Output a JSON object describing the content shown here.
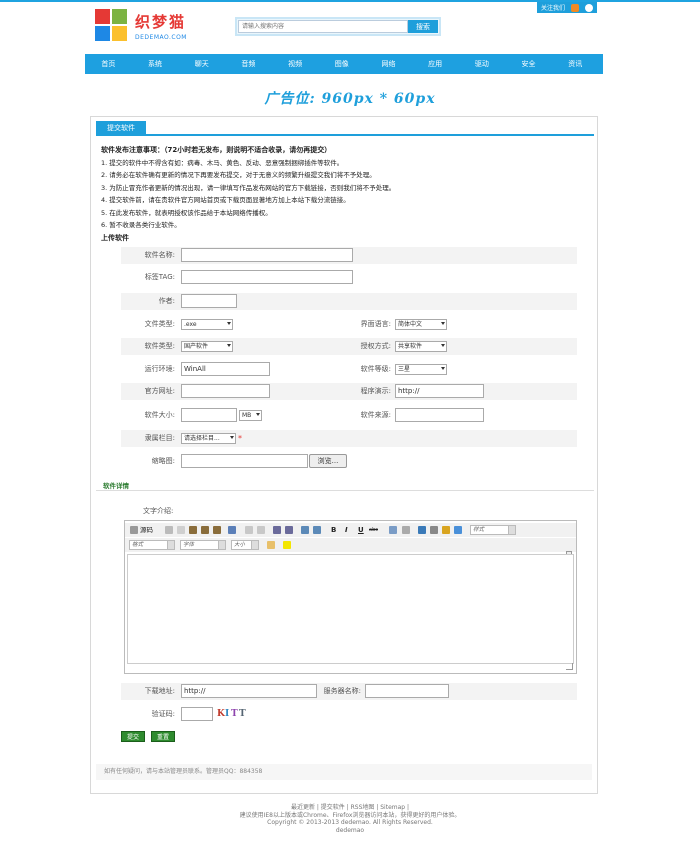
{
  "top": {
    "follow": "关注我们"
  },
  "brand": {
    "name": "织梦猫",
    "sub": "DEDEMAO.COM"
  },
  "search": {
    "placeholder": "请输入搜索内容",
    "button": "搜索"
  },
  "nav": [
    "首页",
    "系统",
    "聊天",
    "音频",
    "视频",
    "图像",
    "网络",
    "应用",
    "驱动",
    "安全",
    "资讯"
  ],
  "ad": "广告位: 960px * 60px",
  "tab": "提交软件",
  "notice": {
    "title": "软件发布注意事项：（72小时若无发布，则说明不适合收录，请勿再提交）",
    "items": [
      "1. 提交的软件中不得含有如：病毒、木马、黄色、反动、恶意强制捆绑插件等软件。",
      "2. 请务必在软件确有更新的情况下再要发布提交，对于无意义的频繁升级提交我们将不予处理。",
      "3. 为防止冒充作者更新的情况出现，请一律填写作品发布网站的官方下载链接，否则我们将不予处理。",
      "4. 提交软件前，请在贵软件官方网站首页或下载页面显著地方加上本站下载分流链接。",
      "5. 在此发布软件，就表明授权该作品给于本站网络传播权。",
      "6. 暂不收录各类行业软件。"
    ],
    "upload_title": "上传软件"
  },
  "form": {
    "name_label": "软件名称:",
    "tag_label": "标签TAG:",
    "author_label": "作者:",
    "filetype_label": "文件类型:",
    "filetype_value": ".exe",
    "lang_label": "界面语言:",
    "lang_value": "简体中文",
    "softtype_label": "软件类型:",
    "softtype_value": "国产软件",
    "license_label": "授权方式:",
    "license_value": "共享软件",
    "env_label": "运行环境:",
    "env_value": "WinAll",
    "rank_label": "软件等级:",
    "rank_value": "三星",
    "site_label": "官方网址:",
    "demo_label": "程序演示:",
    "demo_value": "http://",
    "size_label": "软件大小:",
    "size_unit": "MB",
    "source_label": "软件来源:",
    "cat_label": "隶属栏目:",
    "cat_value": "请选择栏目...",
    "cat_star": "*",
    "thumb_label": "缩略图:",
    "browse": "浏览..."
  },
  "detail": {
    "section": "软件详情",
    "intro_label": "文字介绍:",
    "toolbar": {
      "source": "源码",
      "bold": "B",
      "italic": "I",
      "underline": "U",
      "strike": "abc",
      "style": "样式",
      "format": "格式",
      "font": "字体",
      "size": "大小"
    }
  },
  "download": {
    "url_label": "下载地址:",
    "url_value": "http://",
    "server_label": "服务器名称:"
  },
  "captcha": {
    "label": "验证码:",
    "code": [
      "K",
      "I",
      "T",
      "T"
    ]
  },
  "buttons": {
    "submit": "提交",
    "reset": "重置"
  },
  "note": "如有任何疑问，请与本站管理员联系。管理员QQ：884358",
  "footer": {
    "links": "最近更新 | 提交软件 | RSS地图 | Sitemap |",
    "line2": "建议使用IE8以上版本或Chrome、Firefox浏览器访问本站，获得更好的用户体验。",
    "line3": "Copyright © 2013-2013 dedemao. All Rights Reserved.",
    "line4": "dedemao"
  },
  "colors": {
    "accent": "#1e9fdb",
    "logo_red": "#e53935",
    "logo_green": "#7cb342",
    "logo_blue": "#1e88e5",
    "logo_yellow": "#fbc02d",
    "button_green": "#2e8b2e"
  }
}
